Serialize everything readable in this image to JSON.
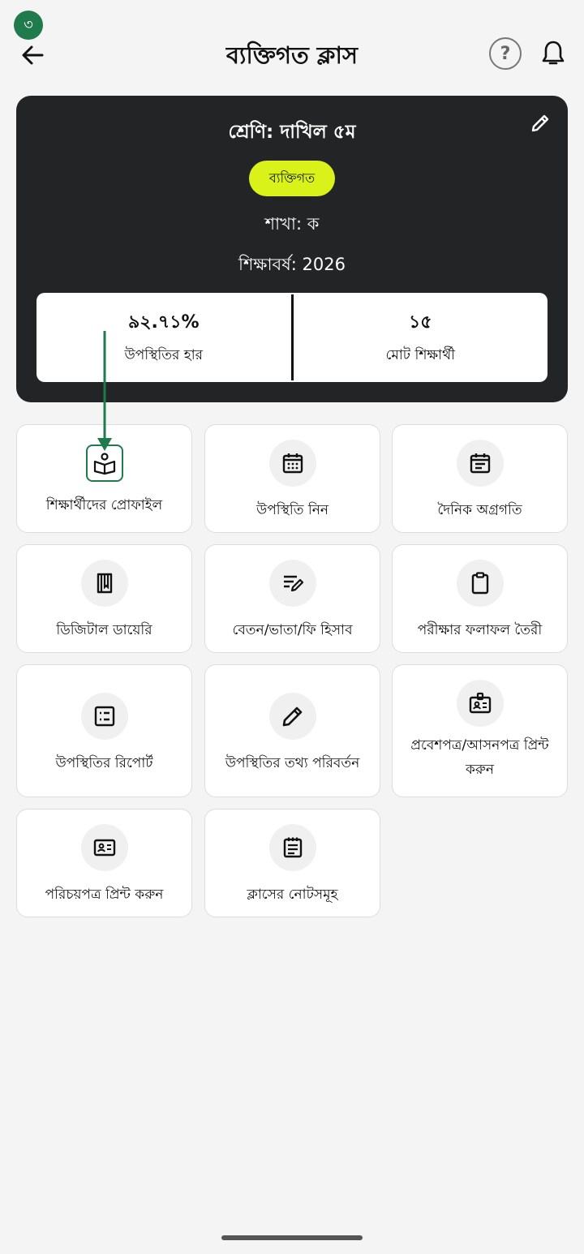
{
  "step_badge": "৩",
  "header": {
    "title": "ব্যক্তিগত ক্লাস",
    "help_symbol": "?"
  },
  "class_card": {
    "class_name": "শ্রেণি: দাখিল ৫ম",
    "type": "ব্যক্তিগত",
    "section": "শাখা: ক",
    "academic_year": "শিক্ষাবর্ষ: 2026",
    "stats": [
      {
        "value": "৯২.৭১%",
        "label": "উপস্থিতির হার"
      },
      {
        "value": "১৫",
        "label": "মোট শিক্ষার্থী"
      }
    ]
  },
  "menu": [
    {
      "label": "শিক্ষার্থীদের প্রোফাইল",
      "icon": "student-profile-book-icon"
    },
    {
      "label": "উপস্থিতি নিন",
      "icon": "calendar-icon"
    },
    {
      "label": "দৈনিক অগ্রগতি",
      "icon": "calendar-list-icon"
    },
    {
      "label": "ডিজিটাল ডায়েরি",
      "icon": "diary-book-icon"
    },
    {
      "label": "বেতন/ভাতা/ফি হিসাব",
      "icon": "edit-note-icon"
    },
    {
      "label": "পরীক্ষার ফলাফল তৈরী",
      "icon": "clipboard-icon"
    },
    {
      "label": "উপস্থিতির রিপোর্ট",
      "icon": "list-report-icon"
    },
    {
      "label": "উপস্থিতির তথ্য পরিবর্তন",
      "icon": "pencil-icon"
    },
    {
      "label": "প্রবেশপত্র/আসনপত্র প্রিন্ট করুন",
      "icon": "admit-badge-icon"
    },
    {
      "label": "পরিচয়পত্র প্রিন্ট করুন",
      "icon": "id-card-icon"
    },
    {
      "label": "ক্লাসের নোটসমূহ",
      "icon": "notes-icon"
    }
  ],
  "colors": {
    "accent": "#1f7a4c",
    "pill": "#d9f21a",
    "card": "#222426"
  }
}
